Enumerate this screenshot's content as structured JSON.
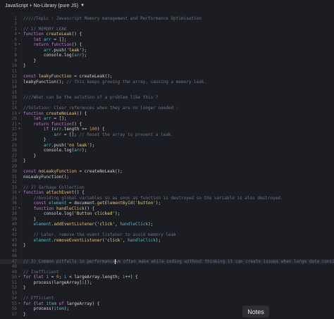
{
  "toolbar": {
    "language_label": "JavaScript + No-Library (pure JS)"
  },
  "notes_button": {
    "label": "Notes"
  },
  "lines": [
    {
      "n": "1",
      "fold": "",
      "segs": [
        [
          "c",
          "/////Topic : Javascript Memory management and Performance Optimisation"
        ]
      ]
    },
    {
      "n": "2",
      "fold": "",
      "segs": []
    },
    {
      "n": "3",
      "fold": "",
      "segs": [
        [
          "c",
          "// 1) MEMORY LEAK"
        ]
      ]
    },
    {
      "n": "4",
      "fold": "▾",
      "segs": [
        [
          "k",
          "function "
        ],
        [
          "f",
          "createLeak"
        ],
        [
          "p",
          "() {"
        ]
      ]
    },
    {
      "n": "5",
      "fold": "",
      "segs": [
        [
          "p",
          "    "
        ],
        [
          "k",
          "let "
        ],
        [
          "v",
          "arr"
        ],
        [
          "p",
          " = [];"
        ]
      ]
    },
    {
      "n": "6",
      "fold": "▾",
      "segs": [
        [
          "p",
          "    "
        ],
        [
          "k",
          "return function"
        ],
        [
          "p",
          "() {"
        ]
      ]
    },
    {
      "n": "7",
      "fold": "",
      "segs": [
        [
          "p",
          "        "
        ],
        [
          "v",
          "arr"
        ],
        [
          "p",
          ".push("
        ],
        [
          "s",
          "'leak'"
        ],
        [
          "p",
          ");"
        ]
      ]
    },
    {
      "n": "8",
      "fold": "",
      "segs": [
        [
          "p",
          "        console.log("
        ],
        [
          "v",
          "arr"
        ],
        [
          "p",
          ");"
        ]
      ]
    },
    {
      "n": "9",
      "fold": "",
      "segs": [
        [
          "p",
          "    }"
        ]
      ]
    },
    {
      "n": "10",
      "fold": "",
      "segs": [
        [
          "p",
          "}"
        ]
      ]
    },
    {
      "n": "11",
      "fold": "",
      "segs": []
    },
    {
      "n": "12",
      "fold": "",
      "segs": [
        [
          "k",
          "const "
        ],
        [
          "f",
          "leakyFunction"
        ],
        [
          "p",
          " = createLeak();"
        ]
      ]
    },
    {
      "n": "13",
      "fold": "",
      "segs": [
        [
          "p",
          "leakyFunction(); "
        ],
        [
          "c",
          "// This keeps growing the array, causing a memory leak."
        ]
      ]
    },
    {
      "n": "14",
      "fold": "",
      "segs": []
    },
    {
      "n": "15",
      "fold": "",
      "segs": []
    },
    {
      "n": "16",
      "fold": "",
      "segs": [
        [
          "c",
          "////What can be the solution of a problem like this ?"
        ]
      ]
    },
    {
      "n": "17",
      "fold": "",
      "segs": []
    },
    {
      "n": "18",
      "fold": "",
      "segs": [
        [
          "c",
          "//Solution: Clear references when they are no longer needed :"
        ]
      ]
    },
    {
      "n": "19",
      "fold": "▾",
      "segs": [
        [
          "k",
          "function "
        ],
        [
          "f",
          "createNoLeak"
        ],
        [
          "p",
          "() {"
        ]
      ]
    },
    {
      "n": "20",
      "fold": "",
      "segs": [
        [
          "p",
          "    "
        ],
        [
          "k",
          "let "
        ],
        [
          "v",
          "arr"
        ],
        [
          "p",
          " = [];"
        ]
      ]
    },
    {
      "n": "21",
      "fold": "▾",
      "segs": [
        [
          "p",
          "    "
        ],
        [
          "k",
          "return function"
        ],
        [
          "p",
          "() {"
        ]
      ]
    },
    {
      "n": "22",
      "fold": "▾",
      "segs": [
        [
          "p",
          "        "
        ],
        [
          "k",
          "if "
        ],
        [
          "p",
          "("
        ],
        [
          "v",
          "arr"
        ],
        [
          "p",
          ".length >= "
        ],
        [
          "n",
          "100"
        ],
        [
          "p",
          ") {"
        ]
      ]
    },
    {
      "n": "23",
      "fold": "",
      "segs": [
        [
          "p",
          "            "
        ],
        [
          "v",
          "arr"
        ],
        [
          "p",
          " = []; "
        ],
        [
          "c",
          "// Reset the array to prevent a leak."
        ]
      ]
    },
    {
      "n": "24",
      "fold": "",
      "segs": [
        [
          "p",
          "        }"
        ]
      ]
    },
    {
      "n": "25",
      "fold": "",
      "segs": [
        [
          "p",
          "        "
        ],
        [
          "v",
          "arr"
        ],
        [
          "p",
          ".push("
        ],
        [
          "s",
          "'no leak'"
        ],
        [
          "p",
          ");"
        ]
      ]
    },
    {
      "n": "26",
      "fold": "",
      "segs": [
        [
          "p",
          "        console.log("
        ],
        [
          "v",
          "arr"
        ],
        [
          "p",
          ");"
        ]
      ]
    },
    {
      "n": "27",
      "fold": "",
      "segs": [
        [
          "p",
          "    }"
        ]
      ]
    },
    {
      "n": "28",
      "fold": "",
      "segs": [
        [
          "p",
          "}"
        ]
      ]
    },
    {
      "n": "29",
      "fold": "",
      "segs": []
    },
    {
      "n": "30",
      "fold": "",
      "segs": [
        [
          "k",
          "const "
        ],
        [
          "f",
          "noLeakyFunction"
        ],
        [
          "p",
          " = createNoLeak();"
        ]
      ]
    },
    {
      "n": "31",
      "fold": "",
      "segs": [
        [
          "p",
          "noLeakyFunction();"
        ]
      ]
    },
    {
      "n": "32",
      "fold": "",
      "segs": []
    },
    {
      "n": "33",
      "fold": "",
      "segs": [
        [
          "c",
          "// 2) Garbage Collection"
        ]
      ]
    },
    {
      "n": "34",
      "fold": "▾",
      "segs": [
        [
          "k",
          "function "
        ],
        [
          "f",
          "attachEvent"
        ],
        [
          "p",
          "() {"
        ]
      ]
    },
    {
      "n": "35",
      "fold": "",
      "segs": [
        [
          "p",
          "    "
        ],
        [
          "c",
          "//Avoiding global variables so as soon as function is destroyed so the variable is also destroyed."
        ]
      ]
    },
    {
      "n": "36",
      "fold": "",
      "segs": [
        [
          "p",
          "    "
        ],
        [
          "k",
          "const "
        ],
        [
          "v",
          "element"
        ],
        [
          "p",
          " = document."
        ],
        [
          "f",
          "getElementById"
        ],
        [
          "p",
          "("
        ],
        [
          "s",
          "'button'"
        ],
        [
          "p",
          ");"
        ]
      ]
    },
    {
      "n": "37",
      "fold": "▾",
      "segs": [
        [
          "p",
          "    "
        ],
        [
          "k",
          "function "
        ],
        [
          "f",
          "handleClick"
        ],
        [
          "p",
          "() {"
        ]
      ]
    },
    {
      "n": "38",
      "fold": "",
      "segs": [
        [
          "p",
          "        console.log("
        ],
        [
          "s",
          "'Button clicked'"
        ],
        [
          "p",
          ");"
        ]
      ]
    },
    {
      "n": "39",
      "fold": "",
      "segs": [
        [
          "p",
          "    }"
        ]
      ]
    },
    {
      "n": "40",
      "fold": "",
      "segs": [
        [
          "p",
          "    "
        ],
        [
          "v",
          "element"
        ],
        [
          "p",
          "."
        ],
        [
          "f",
          "addEventListener"
        ],
        [
          "p",
          "("
        ],
        [
          "s",
          "'click'"
        ],
        [
          "p",
          ", "
        ],
        [
          "v",
          "handleClick"
        ],
        [
          "p",
          ");"
        ]
      ]
    },
    {
      "n": "41",
      "fold": "",
      "segs": []
    },
    {
      "n": "42",
      "fold": "",
      "segs": [
        [
          "p",
          "    "
        ],
        [
          "c",
          "// Later, remove the event listener to avoid memory leak"
        ]
      ]
    },
    {
      "n": "43",
      "fold": "",
      "segs": [
        [
          "p",
          "    "
        ],
        [
          "v",
          "element"
        ],
        [
          "p",
          "."
        ],
        [
          "f",
          "removeEventListener"
        ],
        [
          "p",
          "("
        ],
        [
          "s",
          "'click'"
        ],
        [
          "p",
          ", "
        ],
        [
          "v",
          "handleClick"
        ],
        [
          "p",
          ");"
        ]
      ]
    },
    {
      "n": "44",
      "fold": "",
      "segs": [
        [
          "p",
          "}"
        ]
      ]
    },
    {
      "n": "45",
      "fold": "",
      "segs": []
    },
    {
      "n": "46",
      "fold": "",
      "segs": []
    },
    {
      "n": "47",
      "fold": "",
      "active": true,
      "segs": [
        [
          "c",
          "// 3) Common pitfalls in performance"
        ],
        [
          "cursor",
          ""
        ],
        [
          "c",
          "we often make while coding without thinking it can create issues when large data considered."
        ]
      ]
    },
    {
      "n": "48",
      "fold": "",
      "segs": []
    },
    {
      "n": "49",
      "fold": "",
      "segs": [
        [
          "c",
          "// Inefficient"
        ]
      ]
    },
    {
      "n": "50",
      "fold": "▾",
      "segs": [
        [
          "k",
          "for "
        ],
        [
          "p",
          "("
        ],
        [
          "k",
          "let "
        ],
        [
          "v",
          "i"
        ],
        [
          "p",
          " = "
        ],
        [
          "n",
          "0"
        ],
        [
          "p",
          "; "
        ],
        [
          "v",
          "i"
        ],
        [
          "p",
          " < largeArray.length; "
        ],
        [
          "v",
          "i"
        ],
        [
          "p",
          "++) {"
        ]
      ]
    },
    {
      "n": "51",
      "fold": "",
      "segs": [
        [
          "p",
          "    process(largeArray["
        ],
        [
          "v",
          "i"
        ],
        [
          "p",
          "]);"
        ]
      ]
    },
    {
      "n": "52",
      "fold": "",
      "segs": [
        [
          "p",
          "}"
        ]
      ]
    },
    {
      "n": "53",
      "fold": "",
      "segs": []
    },
    {
      "n": "54",
      "fold": "",
      "segs": [
        [
          "c",
          "// Efficient"
        ]
      ]
    },
    {
      "n": "55",
      "fold": "▾",
      "segs": [
        [
          "k",
          "for "
        ],
        [
          "p",
          "("
        ],
        [
          "k",
          "let "
        ],
        [
          "v",
          "item"
        ],
        [
          "k",
          " of "
        ],
        [
          "p",
          "largeArray) {"
        ]
      ]
    },
    {
      "n": "56",
      "fold": "",
      "segs": [
        [
          "p",
          "    process("
        ],
        [
          "v",
          "item"
        ],
        [
          "p",
          ");"
        ]
      ]
    },
    {
      "n": "57",
      "fold": "",
      "segs": [
        [
          "p",
          "}"
        ]
      ]
    }
  ]
}
